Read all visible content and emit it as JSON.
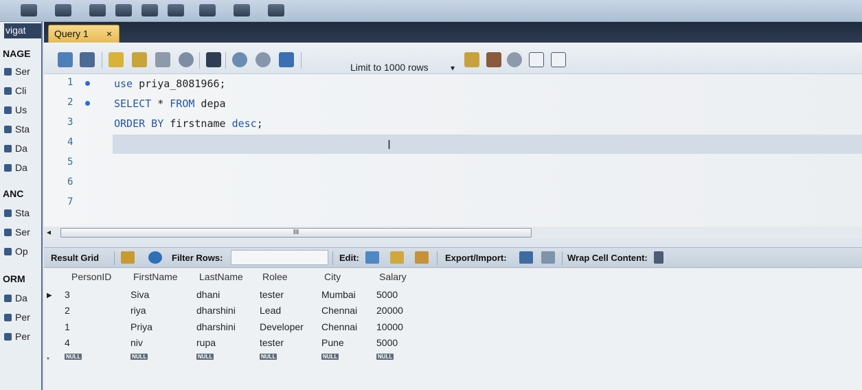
{
  "navigator": {
    "title": "vigat",
    "lines": [
      {
        "text": "NAGE",
        "kind": "head"
      },
      {
        "text": "Ser",
        "kind": "item"
      },
      {
        "text": "Cli",
        "kind": "item"
      },
      {
        "text": "Us",
        "kind": "item"
      },
      {
        "text": "Sta",
        "kind": "item"
      },
      {
        "text": "Da",
        "kind": "item"
      },
      {
        "text": "Da",
        "kind": "item"
      },
      {
        "text": "ANC",
        "kind": "head"
      },
      {
        "text": "Sta",
        "kind": "item"
      },
      {
        "text": "Ser",
        "kind": "item"
      },
      {
        "text": "Op",
        "kind": "item"
      },
      {
        "text": "ORM",
        "kind": "head"
      },
      {
        "text": "Da",
        "kind": "item"
      },
      {
        "text": "Per",
        "kind": "item"
      },
      {
        "text": "Per",
        "kind": "item"
      }
    ]
  },
  "query_tab": {
    "label": "Query 1",
    "close": "×"
  },
  "editor_toolbar": {
    "limit_label": "Limit to 1000 rows",
    "limit_dropdown": "▾",
    "icons": [
      "open-folder-icon",
      "save-icon",
      "execute-icon",
      "execute-current-icon",
      "explain-icon",
      "stop-icon",
      "toggle-icon",
      "commit-icon",
      "rollback-icon",
      "autocommit-icon",
      "beautify-icon",
      "find-icon",
      "search-icon",
      "invisible-chars-icon",
      "wrap-icon"
    ]
  },
  "editor": {
    "lines": [
      {
        "num": "1",
        "dot": true,
        "tokens": [
          {
            "t": "use",
            "kw": true
          },
          {
            "t": " priya_8081966;",
            "kw": false
          }
        ]
      },
      {
        "num": "2",
        "dot": true,
        "tokens": [
          {
            "t": "SELECT",
            "kw": true
          },
          {
            "t": " * ",
            "kw": false
          },
          {
            "t": "FROM",
            "kw": true
          },
          {
            "t": " depa",
            "kw": false
          }
        ]
      },
      {
        "num": "3",
        "dot": false,
        "tokens": [
          {
            "t": "ORDER BY",
            "kw": true
          },
          {
            "t": " firstname ",
            "kw": false
          },
          {
            "t": "desc",
            "kw": true
          },
          {
            "t": ";",
            "kw": false
          }
        ]
      },
      {
        "num": "4",
        "dot": false,
        "tokens": []
      },
      {
        "num": "5",
        "dot": false,
        "tokens": []
      },
      {
        "num": "6",
        "dot": false,
        "tokens": []
      },
      {
        "num": "7",
        "dot": false,
        "tokens": []
      }
    ],
    "cursor_glyph": "I"
  },
  "scrollbar": {
    "left_arrow": "◂",
    "thumb_grip": "III"
  },
  "result_toolbar": {
    "result_grid": "Result Grid",
    "filter_rows": "Filter Rows:",
    "edit": "Edit:",
    "export_import": "Export/Import:",
    "wrap_cell": "Wrap Cell Content:"
  },
  "grid": {
    "columns": [
      "PersonID",
      "FirstName",
      "LastName",
      "Rolee",
      "City",
      "Salary"
    ],
    "rows": [
      [
        "3",
        "Siva",
        "dhani",
        "tester",
        "Mumbai",
        "5000"
      ],
      [
        "2",
        "riya",
        "dharshini",
        "Lead",
        "Chennai",
        "20000"
      ],
      [
        "1",
        "Priya",
        "dharshini",
        "Developer",
        "Chennai",
        "10000"
      ],
      [
        "4",
        "niv",
        "rupa",
        "tester",
        "Pune",
        "5000"
      ]
    ],
    "null_label": "NULL",
    "current_row_marker": "▶",
    "new_row_marker": "*"
  },
  "colors": {
    "keyword": "#2156a8",
    "tab_accent": "#e7bb57"
  }
}
